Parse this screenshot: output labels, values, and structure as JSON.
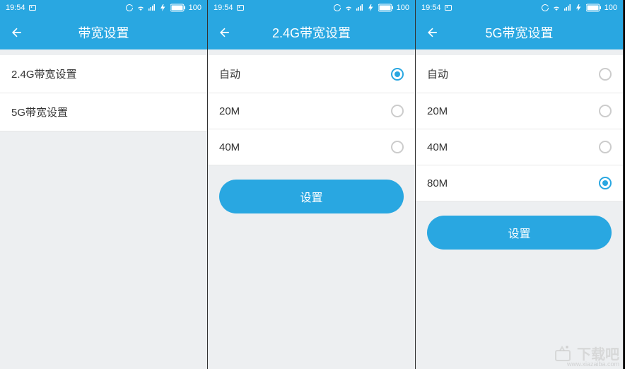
{
  "status": {
    "time": "19:54",
    "battery": "100"
  },
  "screens": [
    {
      "title": "带宽设置",
      "items": [
        {
          "label": "2.4G带宽设置",
          "type": "nav"
        },
        {
          "label": "5G带宽设置",
          "type": "nav"
        }
      ],
      "button": null
    },
    {
      "title": "2.4G带宽设置",
      "items": [
        {
          "label": "自动",
          "type": "radio",
          "checked": true
        },
        {
          "label": "20M",
          "type": "radio",
          "checked": false
        },
        {
          "label": "40M",
          "type": "radio",
          "checked": false
        }
      ],
      "button": "设置"
    },
    {
      "title": "5G带宽设置",
      "items": [
        {
          "label": "自动",
          "type": "radio",
          "checked": false
        },
        {
          "label": "20M",
          "type": "radio",
          "checked": false
        },
        {
          "label": "40M",
          "type": "radio",
          "checked": false
        },
        {
          "label": "80M",
          "type": "radio",
          "checked": true
        }
      ],
      "button": "设置"
    }
  ],
  "watermark": {
    "text": "下载吧",
    "url": "www.xiazaiba.com"
  }
}
